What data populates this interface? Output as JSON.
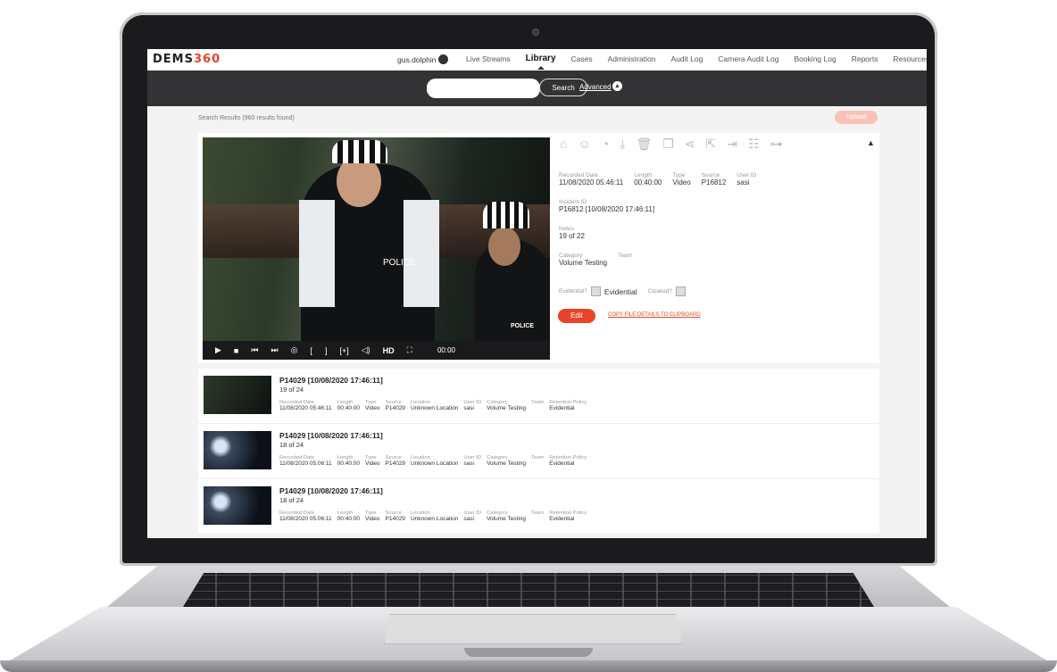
{
  "app": {
    "logo_prefix": "DEMS",
    "logo_suffix": "360",
    "user_name": "gus.dolphin",
    "nav": [
      "Live Streams",
      "Library",
      "Cases",
      "Administration",
      "Audit Log",
      "Camera Audit Log",
      "Booking Log",
      "Reports",
      "Resources"
    ],
    "active_nav": "Library"
  },
  "search": {
    "placeholder": "",
    "button_label": "Search",
    "advanced_label": "Advanced"
  },
  "results": {
    "summary": "Search Results (960 results found)",
    "upload_label": "Upload"
  },
  "player": {
    "overlay_text_1": "POLICE",
    "overlay_text_2": "POLICE",
    "time": "00:00",
    "hd_label": "HD"
  },
  "details": {
    "labels": {
      "recorded_date": "Recorded Date",
      "length": "Length",
      "type": "Type",
      "source": "Source",
      "user_id": "User ID",
      "incident_id": "Incident ID",
      "notes": "Notes",
      "category": "Category",
      "team": "Team",
      "evidential_q": "Evidential?",
      "cloaked_q": "Cloaked?"
    },
    "recorded_date": "11/08/2020 05:46:11",
    "length": "00:40:00",
    "type": "Video",
    "source": "P16812",
    "user_id": "sasi",
    "incident_id": "P16812 [10/08/2020 17:46:11]",
    "notes": "19 of 22",
    "category": "Volume Testing",
    "team": "",
    "evidential_value": "Evidential",
    "edit_label": "Edit",
    "copy_label": "COPY FILE DETAILS TO CLIPBOARD"
  },
  "list_labels": {
    "recorded_date": "Recorded Date",
    "length": "Length",
    "type": "Type",
    "source": "Source",
    "location": "Location",
    "user_id": "User ID",
    "category": "Category",
    "team": "Team",
    "retention": "Retention Policy"
  },
  "rows": [
    {
      "title": "P14029 [10/08/2020 17:46:11]",
      "sub": "19 of 24",
      "recorded_date": "11/08/2020 05:46:11",
      "length": "00:40:00",
      "type": "Video",
      "source": "P14029",
      "location": "Unknown Location",
      "user_id": "sasi",
      "category": "Volume Testing",
      "team": "",
      "retention": "Evidential"
    },
    {
      "title": "P14029 [10/08/2020 17:46:11]",
      "sub": "18 of 24",
      "recorded_date": "11/08/2020 05:06:11",
      "length": "00:40:00",
      "type": "Video",
      "source": "P14029",
      "location": "Unknown Location",
      "user_id": "sasi",
      "category": "Volume Testing",
      "team": "",
      "retention": "Evidential"
    },
    {
      "title": "P14029 [10/08/2020 17:46:11]",
      "sub": "18 of 24",
      "recorded_date": "11/08/2020 05:06:11",
      "length": "00:40:00",
      "type": "Video",
      "source": "P14029",
      "location": "Unknown Location",
      "user_id": "sasi",
      "category": "Volume Testing",
      "team": "",
      "retention": "Evidential"
    }
  ]
}
